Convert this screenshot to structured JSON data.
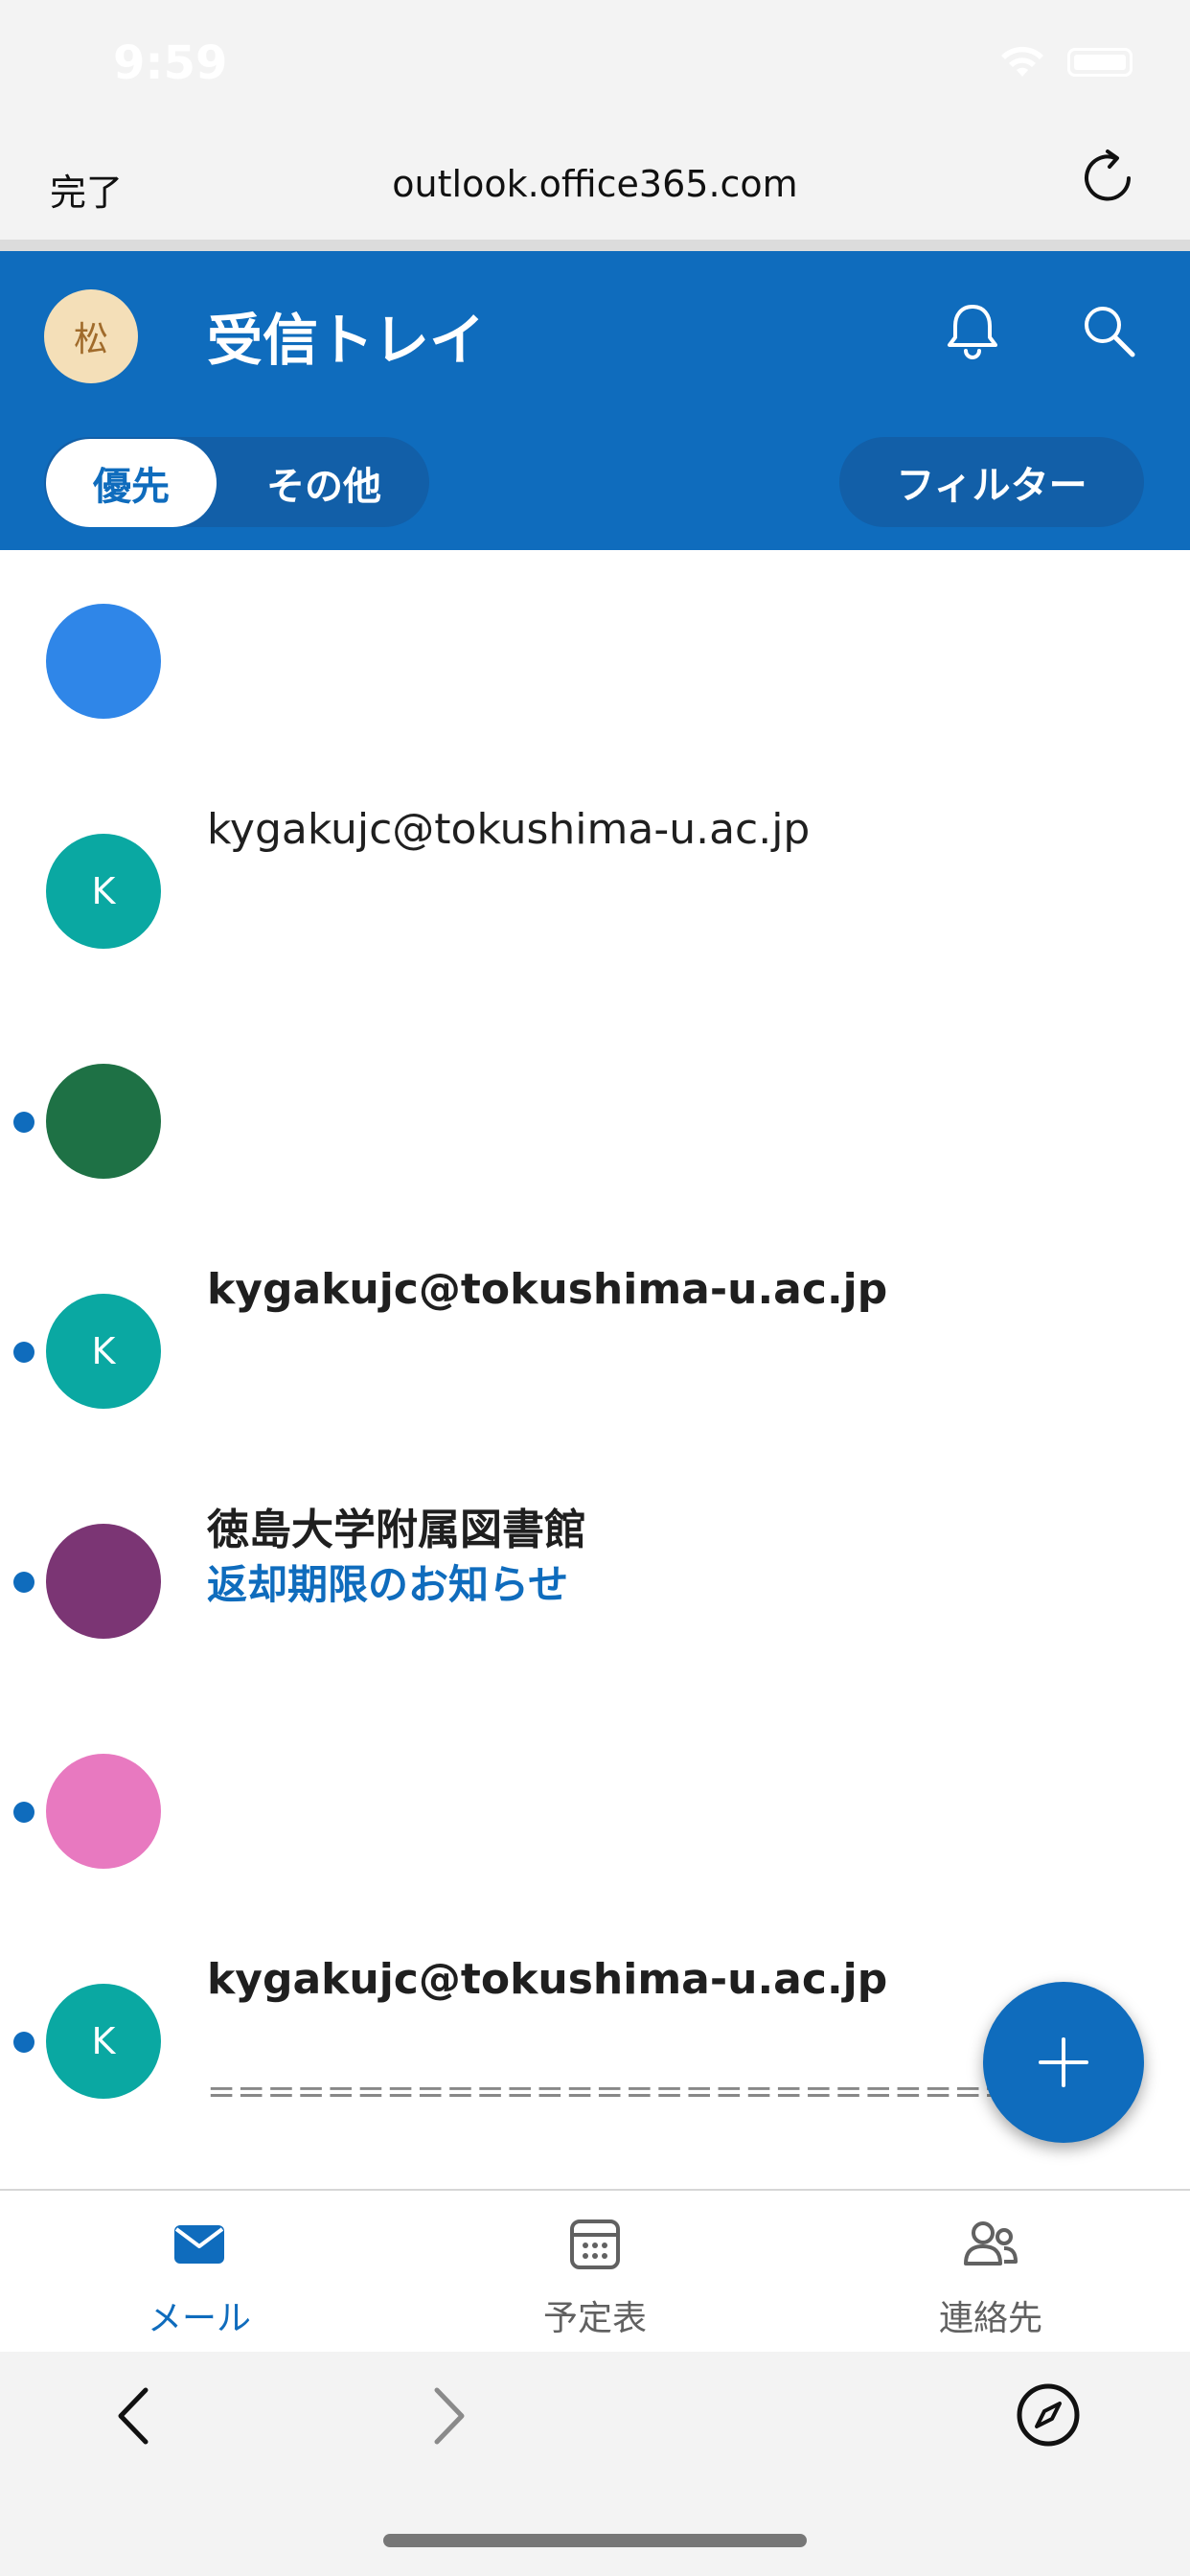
{
  "status_bar": {
    "time": "9:59"
  },
  "browser": {
    "done_label": "完了",
    "url": "outlook.office365.com"
  },
  "header": {
    "avatar_initial": "松",
    "title": "受信トレイ",
    "tabs": [
      {
        "label": "優先",
        "selected": true
      },
      {
        "label": "その他",
        "selected": false
      }
    ],
    "filter_label": "フィルター"
  },
  "mails": [
    {
      "unread": false,
      "avatar_color": "#2f86e8",
      "avatar_initial": "",
      "sender": "",
      "subject": "",
      "preview": ""
    },
    {
      "unread": false,
      "avatar_color": "#0aa8a2",
      "avatar_initial": "K",
      "sender": "kygakujc@tokushima-u.ac.jp",
      "subject": "",
      "preview": ""
    },
    {
      "unread": true,
      "avatar_color": "#1e7145",
      "avatar_initial": "",
      "sender": "",
      "subject": "",
      "preview": ""
    },
    {
      "unread": true,
      "avatar_color": "#0aa8a2",
      "avatar_initial": "K",
      "sender": "kygakujc@tokushima-u.ac.jp",
      "subject": "",
      "preview": ""
    },
    {
      "unread": true,
      "avatar_color": "#7b3574",
      "avatar_initial": "",
      "sender": "徳島大学附属図書館",
      "subject": "返却期限のお知らせ",
      "preview": ""
    },
    {
      "unread": true,
      "avatar_color": "#e879c0",
      "avatar_initial": "",
      "sender": "",
      "subject": "",
      "preview": ""
    },
    {
      "unread": true,
      "avatar_color": "#0aa8a2",
      "avatar_initial": "K",
      "sender": "kygakujc@tokushima-u.ac.jp",
      "subject": "",
      "preview": "================================================"
    }
  ],
  "bottom_nav": [
    {
      "label": "メール",
      "icon": "mail-icon",
      "active": true
    },
    {
      "label": "予定表",
      "icon": "calendar-icon",
      "active": false
    },
    {
      "label": "連絡先",
      "icon": "contacts-icon",
      "active": false
    }
  ],
  "colors": {
    "accent": "#0f6cbd",
    "unread_dot": "#0f6cbd"
  }
}
